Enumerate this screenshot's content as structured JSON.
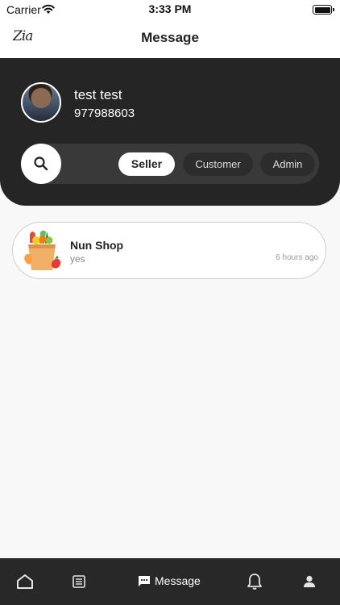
{
  "status_bar": {
    "carrier": "Carrier",
    "time": "3:33 PM"
  },
  "header": {
    "logo": "Zia",
    "title": "Message"
  },
  "profile": {
    "name": "test test",
    "phone": "977988603"
  },
  "filters": {
    "tabs": [
      {
        "label": "Seller",
        "selected": true
      },
      {
        "label": "Customer",
        "selected": false
      },
      {
        "label": "Admin",
        "selected": false
      }
    ]
  },
  "conversations": [
    {
      "shop_name": "Nun Shop",
      "last_message": "yes",
      "time": "6 hours ago",
      "icon": "grocery-bag-icon"
    }
  ],
  "bottom_nav": {
    "items": [
      {
        "icon": "home-icon",
        "label": "",
        "active": false
      },
      {
        "icon": "list-icon",
        "label": "",
        "active": false
      },
      {
        "icon": "message-icon",
        "label": "Message",
        "active": true
      },
      {
        "icon": "bell-icon",
        "label": "",
        "active": false
      },
      {
        "icon": "profile-icon",
        "label": "",
        "active": false
      }
    ]
  },
  "colors": {
    "dark": "#252525",
    "accent": "#ffffff",
    "background": "#f8f8f8"
  }
}
